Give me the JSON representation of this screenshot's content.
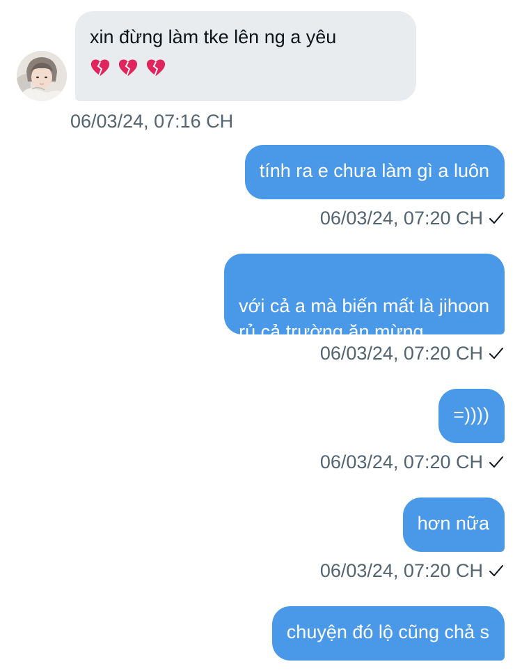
{
  "conversation": {
    "incoming": {
      "text": "xin đừng làm tke lên ng a yêu",
      "emojis": [
        "broken-heart",
        "broken-heart",
        "broken-heart"
      ],
      "timestamp": "06/03/24, 07:16 CH"
    },
    "outgoing": [
      {
        "text": "tính ra e chưa làm gì a luôn",
        "timestamp": "06/03/24, 07:20 CH"
      },
      {
        "text": "với cả a mà biến mất là jihoon\nrủ cả trường ăn mừng",
        "timestamp": "06/03/24, 07:20 CH"
      },
      {
        "text": "=))))",
        "timestamp": "06/03/24, 07:20 CH"
      },
      {
        "text": "hơn nữa",
        "timestamp": "06/03/24, 07:20 CH"
      },
      {
        "text": "chuyện đó lộ cũng chả s",
        "timestamp": ""
      }
    ]
  },
  "colors": {
    "outgoing_bubble": "#4a99e9",
    "incoming_bubble": "#e8ecef",
    "timestamp_text": "#536471",
    "broken_heart": "#e0245e"
  },
  "icons": [
    "avatar",
    "broken-heart-icon",
    "sent-check-icon"
  ]
}
